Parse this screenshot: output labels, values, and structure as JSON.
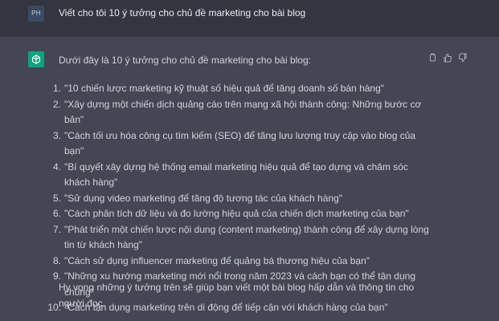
{
  "user": {
    "avatar_initials": "PH",
    "message": "Viết cho tôi 10 ý tưởng cho chủ đề marketing cho bài blog"
  },
  "assistant": {
    "intro": "Dưới đây là 10 ý tưởng cho chủ đề marketing cho bài blog:",
    "ideas": [
      {
        "num": "1.",
        "text": "\"10 chiến lược marketing kỹ thuật số hiệu quả để tăng doanh số bán hàng\""
      },
      {
        "num": "2.",
        "text": "\"Xây dựng một chiến dịch quảng cáo trên mạng xã hội thành công: Những bước cơ bản\""
      },
      {
        "num": "3.",
        "text": "\"Cách tối ưu hóa công cụ tìm kiếm (SEO) để tăng lưu lượng truy cập vào blog của bạn\""
      },
      {
        "num": "4.",
        "text": "\"Bí quyết xây dựng hệ thống email marketing hiệu quả để tạo dựng và chăm sóc khách hàng\""
      },
      {
        "num": "5.",
        "text": "\"Sử dụng video marketing để tăng độ tương tác của khách hàng\""
      },
      {
        "num": "6.",
        "text": "\"Cách phân tích dữ liệu và đo lường hiệu quả của chiến dịch marketing của bạn\""
      },
      {
        "num": "7.",
        "text": "\"Phát triển một chiến lược nội dung (content marketing) thành công để xây dựng lòng tin từ khách hàng\""
      },
      {
        "num": "8.",
        "text": "\"Cách sử dụng influencer marketing để quảng bá thương hiệu của bạn\""
      },
      {
        "num": "9.",
        "text": "\"Những xu hướng marketing mới nổi trong năm 2023 và cách bạn có thể tận dụng chúng\""
      },
      {
        "num": "10.",
        "text": "\"Cách tận dụng marketing trên di động để tiếp cận với khách hàng của bạn\""
      }
    ],
    "outro": "Hy vọng những ý tưởng trên sẽ giúp bạn viết một bài blog hấp dẫn và thông tin cho người đọc.",
    "actions": [
      "copy-icon",
      "thumbs-up-icon",
      "thumbs-down-icon"
    ]
  },
  "colors": {
    "user_bg": "#343541",
    "assistant_bg": "#444654",
    "accent": "#10a37f"
  }
}
